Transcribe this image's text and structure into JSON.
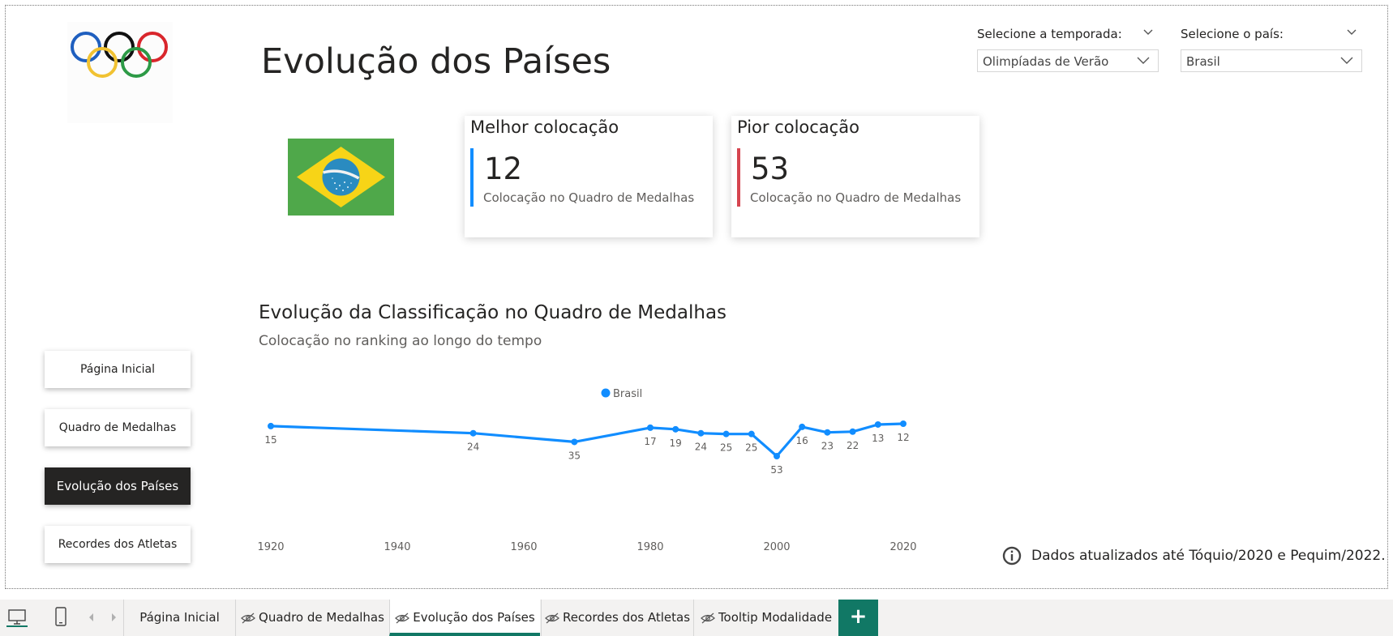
{
  "page": {
    "title": "Evolução dos Países"
  },
  "filters": {
    "season": {
      "label": "Selecione a temporada:",
      "value": "Olimpíadas de Verão"
    },
    "country": {
      "label": "Selecione o país:",
      "value": "Brasil"
    }
  },
  "cards": {
    "best": {
      "title": "Melhor colocação",
      "value": "12",
      "subtitle": "Colocação no Quadro de Medalhas",
      "accent": "#118DFF"
    },
    "worst": {
      "title": "Pior colocação",
      "value": "53",
      "subtitle": "Colocação no Quadro de Medalhas",
      "accent": "#D64550"
    }
  },
  "nav": {
    "buttons": [
      {
        "label": "Página Inicial",
        "active": false
      },
      {
        "label": "Quadro de Medalhas",
        "active": false
      },
      {
        "label": "Evolução dos Países",
        "active": true
      },
      {
        "label": "Recordes dos Atletas",
        "active": false
      }
    ]
  },
  "chart": {
    "title": "Evolução da Classificação no Quadro de Medalhas",
    "subtitle": "Colocação no ranking ao longo do tempo"
  },
  "chart_data": {
    "type": "line",
    "title": "Evolução da Classificação no Quadro de Medalhas",
    "subtitle": "Colocação no ranking ao longo do tempo",
    "xlabel": "",
    "ylabel": "",
    "x_ticks": [
      1920,
      1940,
      1960,
      1980,
      2000,
      2020
    ],
    "y_inverted": true,
    "legend_position": "top-center",
    "series": [
      {
        "name": "Brasil",
        "color": "#118DFF",
        "x": [
          1920,
          1952,
          1968,
          1980,
          1984,
          1988,
          1992,
          1996,
          2000,
          2004,
          2008,
          2012,
          2016,
          2020
        ],
        "y": [
          15,
          24,
          35,
          17,
          19,
          24,
          25,
          25,
          53,
          16,
          23,
          22,
          13,
          12
        ]
      }
    ]
  },
  "info": {
    "icon": "info-icon",
    "text": "Dados atualizados até Tóquio/2020 e Pequim/2022."
  },
  "tabs": [
    {
      "label": "Página Inicial",
      "hidden": false,
      "active": false
    },
    {
      "label": "Quadro de Medalhas",
      "hidden": true,
      "active": false
    },
    {
      "label": "Evolução dos Países",
      "hidden": true,
      "active": true
    },
    {
      "label": "Recordes dos Atletas",
      "hidden": true,
      "active": false
    },
    {
      "label": "Tooltip Modalidade",
      "hidden": true,
      "active": false
    }
  ],
  "add_tab": "+",
  "colors": {
    "accent": "#117865",
    "line": "#118DFF"
  }
}
